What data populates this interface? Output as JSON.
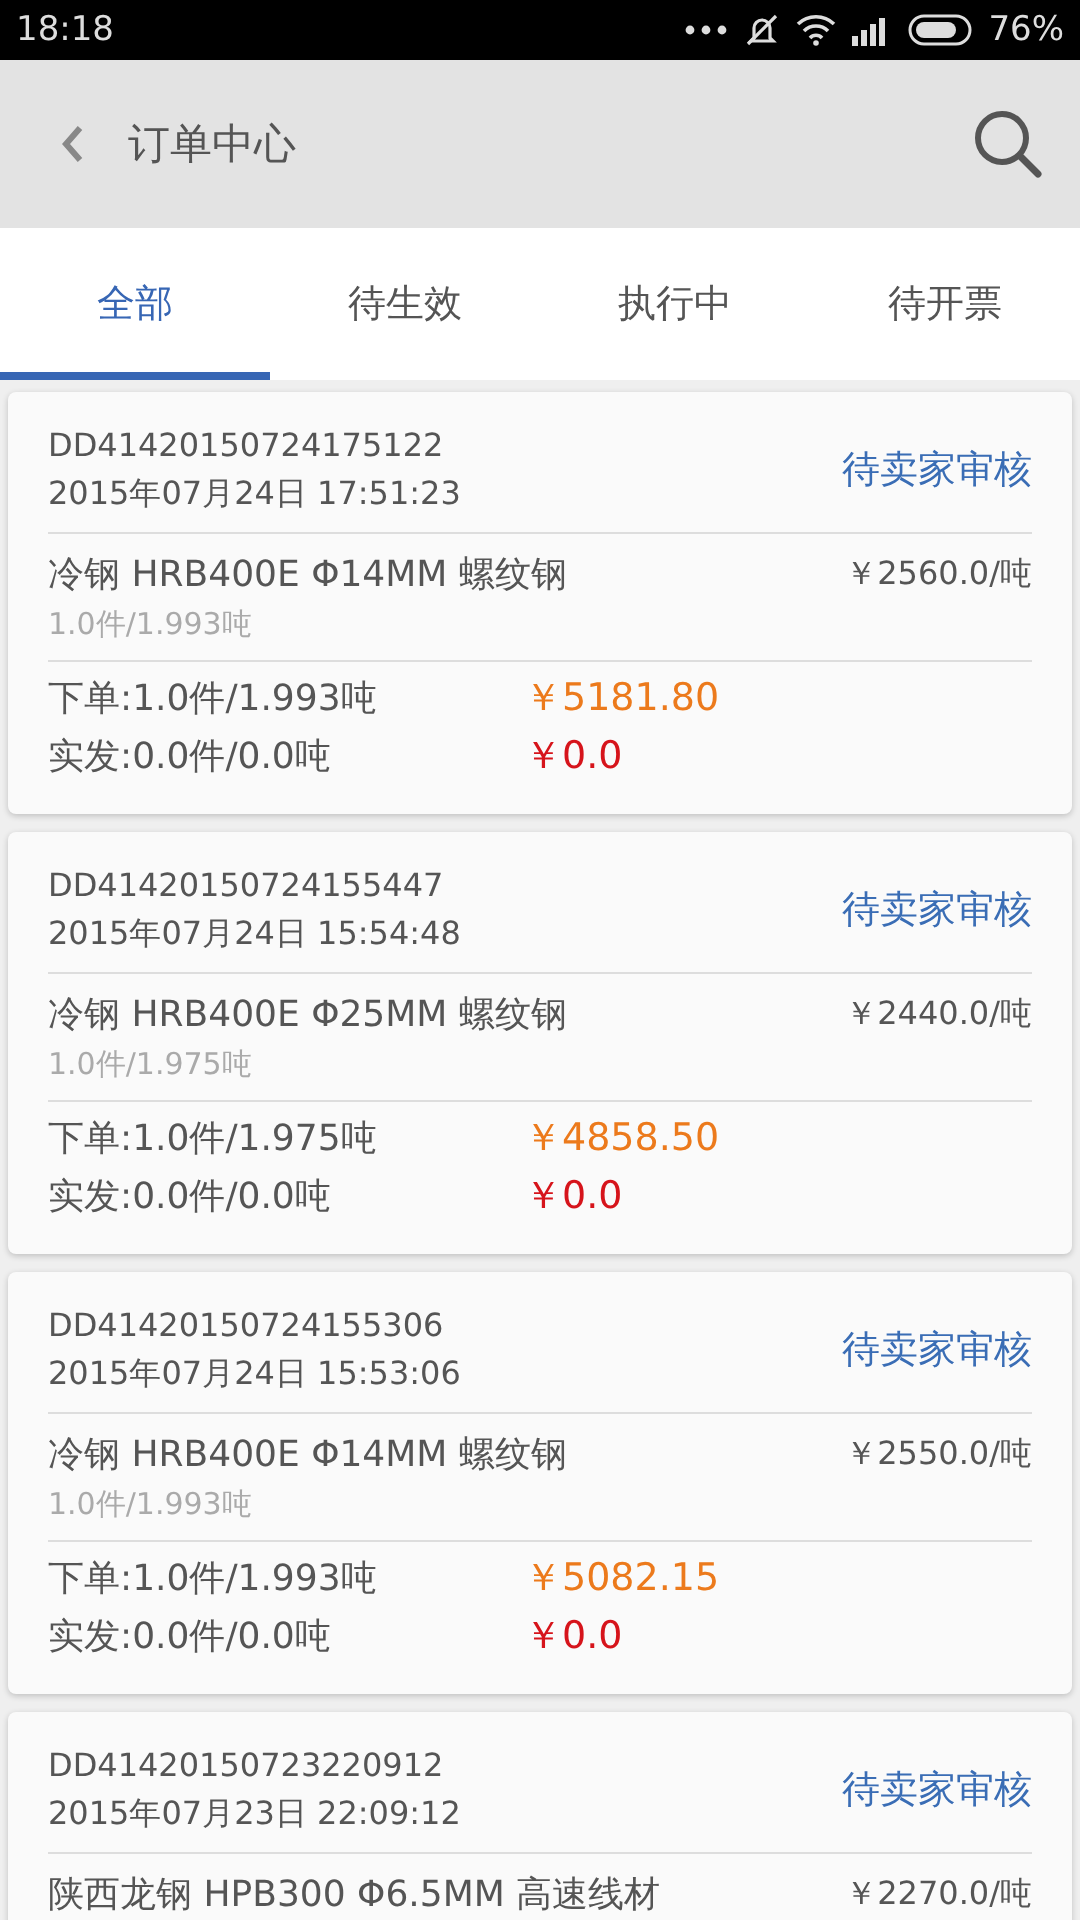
{
  "status_bar": {
    "time": "18:18",
    "battery": "76%"
  },
  "header": {
    "title": "订单中心"
  },
  "tabs": [
    {
      "label": "全部",
      "selected": true
    },
    {
      "label": "待生效",
      "selected": false
    },
    {
      "label": "执行中",
      "selected": false
    },
    {
      "label": "待开票",
      "selected": false
    }
  ],
  "orders": [
    {
      "order_no": "DD41420150724175122",
      "date": "2015年07月24日 17:51:23",
      "status": "待卖家审核",
      "product": "冷钢 HRB400E Φ14MM 螺纹钢",
      "unit_price": "￥2560.0/吨",
      "quantity": "1.0件/1.993吨",
      "ordered": "下单:1.0件/1.993吨",
      "ordered_amount": "￥5181.80",
      "shipped": "实发:0.0件/0.0吨",
      "shipped_amount": "￥0.0"
    },
    {
      "order_no": "DD41420150724155447",
      "date": "2015年07月24日 15:54:48",
      "status": "待卖家审核",
      "product": "冷钢 HRB400E Φ25MM 螺纹钢",
      "unit_price": "￥2440.0/吨",
      "quantity": "1.0件/1.975吨",
      "ordered": "下单:1.0件/1.975吨",
      "ordered_amount": "￥4858.50",
      "shipped": "实发:0.0件/0.0吨",
      "shipped_amount": "￥0.0"
    },
    {
      "order_no": "DD41420150724155306",
      "date": "2015年07月24日 15:53:06",
      "status": "待卖家审核",
      "product": "冷钢 HRB400E Φ14MM 螺纹钢",
      "unit_price": "￥2550.0/吨",
      "quantity": "1.0件/1.993吨",
      "ordered": "下单:1.0件/1.993吨",
      "ordered_amount": "￥5082.15",
      "shipped": "实发:0.0件/0.0吨",
      "shipped_amount": "￥0.0"
    },
    {
      "order_no": "DD41420150723220912",
      "date": "2015年07月23日 22:09:12",
      "status": "待卖家审核",
      "product": "陕西龙钢 HPB300 Φ6.5MM 高速线材",
      "unit_price": "￥2270.0/吨"
    }
  ]
}
